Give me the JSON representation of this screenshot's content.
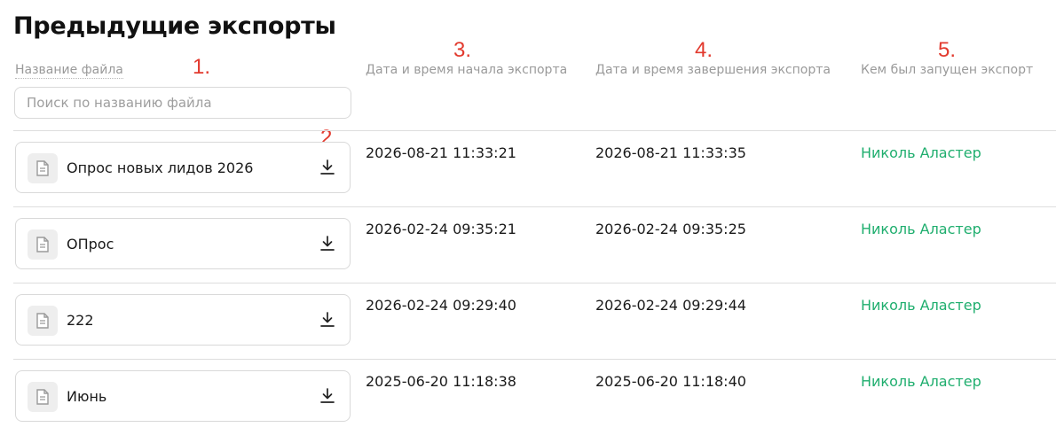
{
  "page": {
    "title": "Предыдущие экспорты"
  },
  "columns": {
    "file_name": "Название файла",
    "start_time": "Дата и время начала экспорта",
    "end_time": "Дата и время завершения экспорта",
    "launched_by": "Кем был запущен экспорт"
  },
  "search": {
    "value": "",
    "placeholder": "Поиск по названию файла"
  },
  "markers": {
    "m1": "1.",
    "m2": "2.",
    "m3": "3.",
    "m4": "4.",
    "m5": "5."
  },
  "colors": {
    "accent_green": "#1fae6e",
    "marker_red": "#e23a2e"
  },
  "icons": {
    "file": "document-icon",
    "download": "download-icon"
  },
  "exports": [
    {
      "file_name": "Опрос новых лидов 2026",
      "start": "2026-08-21 11:33:21",
      "end": "2026-08-21 11:33:35",
      "user": "Николь Аластер"
    },
    {
      "file_name": "ОПрос",
      "start": "2026-02-24 09:35:21",
      "end": "2026-02-24 09:35:25",
      "user": "Николь Аластер"
    },
    {
      "file_name": "222",
      "start": "2026-02-24 09:29:40",
      "end": "2026-02-24 09:29:44",
      "user": "Николь Аластер"
    },
    {
      "file_name": "Июнь",
      "start": "2025-06-20 11:18:38",
      "end": "2025-06-20 11:18:40",
      "user": "Николь Аластер"
    }
  ]
}
